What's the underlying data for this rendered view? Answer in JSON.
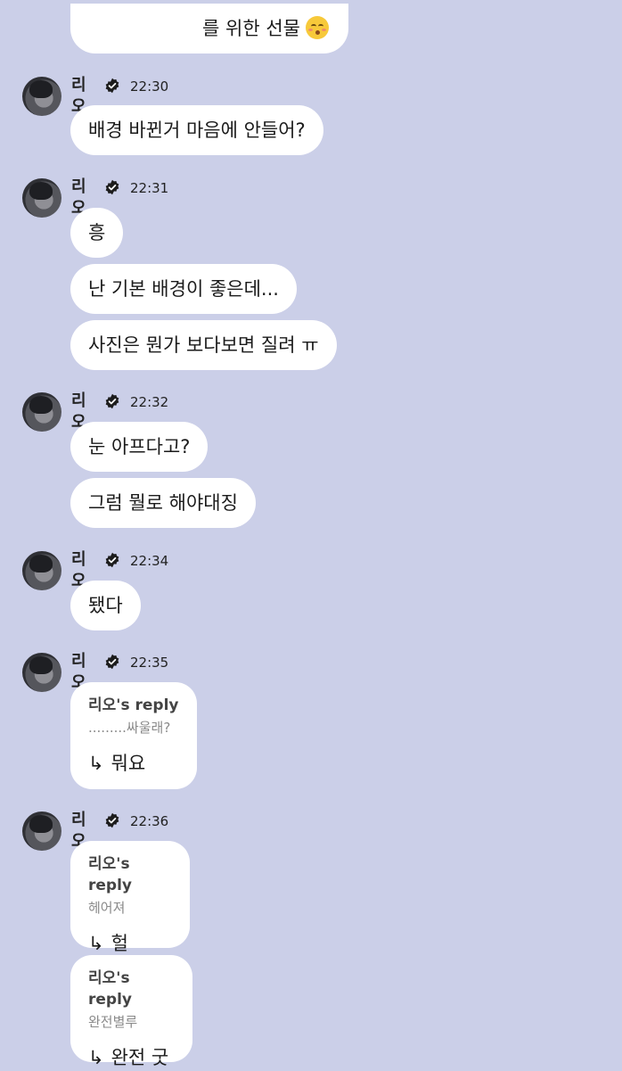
{
  "top_bubble": {
    "text": "를 위한 선물",
    "emoji": "kissing-face-emoji"
  },
  "messages": [
    {
      "name": "리오",
      "time": "22:30",
      "bubbles": [
        "배경 바뀐거 마음에 안들어?"
      ]
    },
    {
      "name": "리오",
      "time": "22:31",
      "bubbles": [
        "흥",
        "난 기본 배경이 좋은데...",
        "사진은 뭔가 보다보면 질려 ㅠ"
      ]
    },
    {
      "name": "리오",
      "time": "22:32",
      "bubbles": [
        "눈 아프다고?",
        "그럼 뭘로 해야대징"
      ]
    },
    {
      "name": "리오",
      "time": "22:34",
      "bubbles": [
        "됐다"
      ]
    },
    {
      "name": "리오",
      "time": "22:35",
      "replies": [
        {
          "reply_name": "리오's reply",
          "quote": ".........싸울래?",
          "arrow": "↳",
          "text": "뭐요"
        }
      ]
    },
    {
      "name": "리오",
      "time": "22:36",
      "replies": [
        {
          "reply_name": "리오's reply",
          "quote": "헤어져",
          "arrow": "↳",
          "text": "헐"
        },
        {
          "reply_name": "리오's reply",
          "quote": "완전별루",
          "arrow": "↳",
          "text": "완전 굿"
        }
      ]
    }
  ],
  "icons": {
    "verified": "verified-badge-icon",
    "avatar": "profile-avatar"
  },
  "colors": {
    "background": "#cbcfe8",
    "bubble": "#ffffff",
    "verified": "#1c1c1c"
  }
}
